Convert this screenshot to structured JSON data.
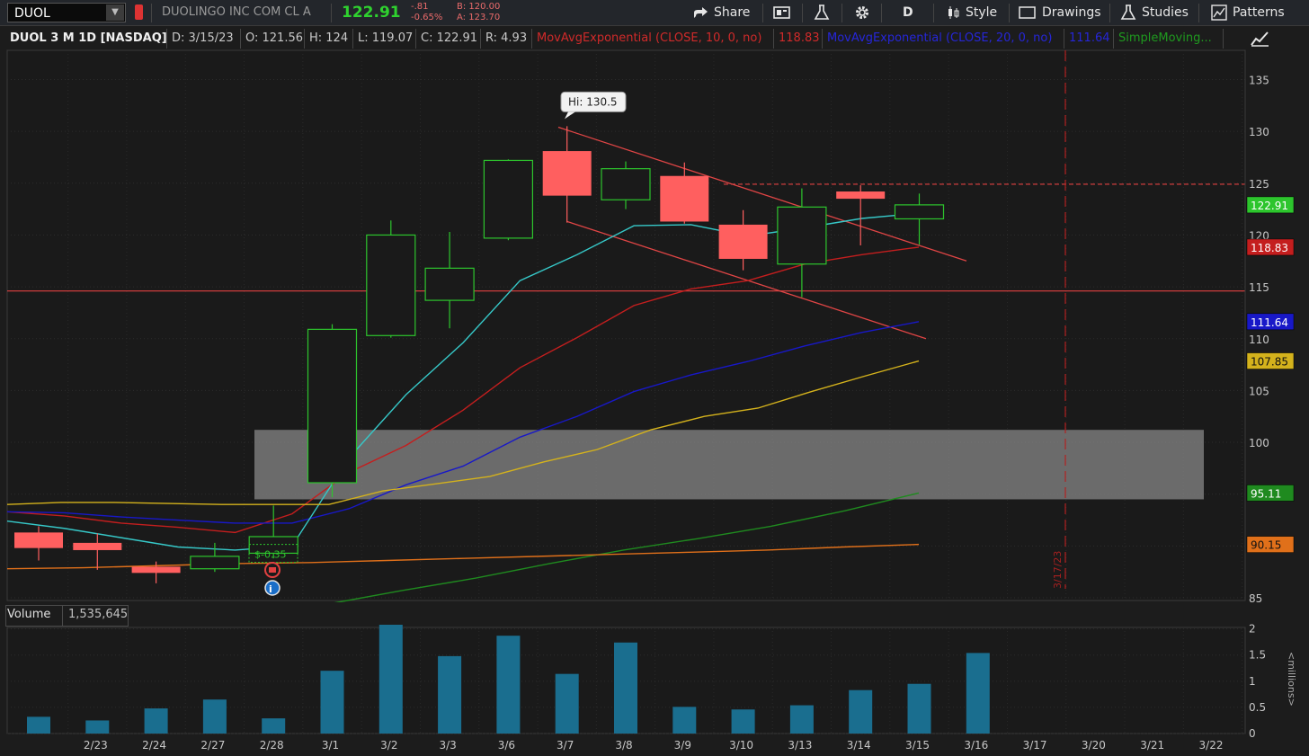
{
  "toolbar": {
    "symbol": "DUOL",
    "company": "DUOLINGO INC COM CL A",
    "last": "122.91",
    "net_change": "-.81",
    "pct_change": "-0.65%",
    "bid": "B: 120.00",
    "ask": "A: 123.70",
    "share": "Share",
    "period_button": "D",
    "style": "Style",
    "drawings": "Drawings",
    "studies": "Studies",
    "patterns": "Patterns"
  },
  "study_header": {
    "title": "DUOL 3 M 1D [NASDAQ]",
    "date": "D: 3/15/23",
    "open": "O: 121.56",
    "high": "H: 124",
    "low": "L: 119.07",
    "close": "C: 122.91",
    "range": "R: 4.93",
    "ema10_label": "MovAvgExponential (CLOSE, 10, 0, no)",
    "ema10_value": "118.83",
    "ema20_label": "MovAvgExponential (CLOSE, 20, 0, no)",
    "ema20_value": "111.64",
    "sma_label": "SimpleMoving..."
  },
  "volume_pane": {
    "label": "Volume",
    "value": "1,535,645",
    "unit_label": "<millions>"
  },
  "colors": {
    "up": "#2dc52d",
    "down": "#ff5f5f",
    "ema10": "#c41e1e",
    "ema20": "#1818c8",
    "ema8": "#36c8c8",
    "sma_yellow": "#d4b21c",
    "sma_green": "#1f8a1f",
    "sma_orange": "#e0701a",
    "volume": "#1a6e8f"
  },
  "chart_data": {
    "type": "candlestick",
    "x_labels": [
      "2/23",
      "2/24",
      "2/27",
      "2/28",
      "3/1",
      "3/2",
      "3/3",
      "3/6",
      "3/7",
      "3/8",
      "3/9",
      "3/10",
      "3/13",
      "3/14",
      "3/15",
      "3/16",
      "3/17",
      "3/20",
      "3/21",
      "3/22"
    ],
    "candles": [
      {
        "date": "2/22",
        "open": 91.3,
        "high": 91.9,
        "low": 88.6,
        "close": 89.8
      },
      {
        "date": "2/23",
        "open": 90.3,
        "high": 91.2,
        "low": 87.7,
        "close": 89.6
      },
      {
        "date": "2/24",
        "open": 88.0,
        "high": 88.5,
        "low": 86.4,
        "close": 87.4
      },
      {
        "date": "2/27",
        "open": 87.8,
        "high": 90.3,
        "low": 87.5,
        "close": 89.0
      },
      {
        "date": "2/28",
        "open": 89.3,
        "high": 93.9,
        "low": 88.8,
        "close": 90.9
      },
      {
        "date": "3/1",
        "open": 96.1,
        "high": 111.4,
        "low": 94.7,
        "close": 110.9
      },
      {
        "date": "3/2",
        "open": 110.3,
        "high": 121.4,
        "low": 110.1,
        "close": 120.0
      },
      {
        "date": "3/3",
        "open": 113.7,
        "high": 120.3,
        "low": 111.0,
        "close": 116.8
      },
      {
        "date": "3/6",
        "open": 119.7,
        "high": 127.3,
        "low": 119.5,
        "close": 127.2
      },
      {
        "date": "3/7",
        "open": 128.1,
        "high": 130.5,
        "low": 121.2,
        "close": 123.8
      },
      {
        "date": "3/8",
        "open": 123.4,
        "high": 127.1,
        "low": 122.5,
        "close": 126.4
      },
      {
        "date": "3/9",
        "open": 125.7,
        "high": 127.0,
        "low": 121.1,
        "close": 121.3
      },
      {
        "date": "3/10",
        "open": 121.0,
        "high": 122.4,
        "low": 116.6,
        "close": 117.7
      },
      {
        "date": "3/13",
        "open": 117.2,
        "high": 124.5,
        "low": 114.0,
        "close": 122.7
      },
      {
        "date": "3/14",
        "open": 124.2,
        "high": 124.8,
        "low": 119.0,
        "close": 123.5
      },
      {
        "date": "3/15",
        "open": 121.56,
        "high": 124.0,
        "low": 119.07,
        "close": 122.91
      }
    ],
    "moving_averages": [
      {
        "name": "MovAvgExponential (CLOSE, 10, 0, no)",
        "color": "#c41e1e",
        "values": [
          93.3,
          92.9,
          92.2,
          91.8,
          91.3,
          93.1,
          97.1,
          99.7,
          103.1,
          107.2,
          110.1,
          113.2,
          114.8,
          115.6,
          117.2,
          118.1,
          118.83
        ]
      },
      {
        "name": "MovAvgExponential (CLOSE, 20, 0, no)",
        "color": "#1818c8",
        "values": [
          93.3,
          93.2,
          92.8,
          92.5,
          92.2,
          92.2,
          93.6,
          95.9,
          97.7,
          100.5,
          102.5,
          104.9,
          106.5,
          107.8,
          109.3,
          110.6,
          111.64
        ]
      },
      {
        "name": "EMA (8)",
        "color": "#36c8c8",
        "values": [
          92.4,
          91.7,
          90.8,
          89.9,
          89.6,
          90.0,
          98.5,
          104.6,
          109.6,
          115.6,
          118.1,
          120.9,
          121.0,
          119.9,
          120.7,
          121.6,
          122.1
        ]
      },
      {
        "name": "SimpleMoving (yellow)",
        "color": "#d4b21c",
        "values": [
          94.0,
          94.2,
          94.2,
          94.1,
          94.0,
          94.0,
          94.0,
          95.3,
          96.0,
          96.7,
          98.1,
          99.3,
          101.2,
          102.5,
          103.3,
          104.9,
          106.4,
          107.85
        ]
      },
      {
        "name": "SimpleMoving (green)",
        "color": "#1f8a1f",
        "values": [
          84.4,
          85.7,
          86.9,
          88.3,
          89.6,
          90.7,
          91.9,
          93.4,
          95.11
        ]
      },
      {
        "name": "SimpleMoving (orange)",
        "color": "#e0701a",
        "values": [
          87.8,
          87.9,
          88.1,
          88.3,
          88.4,
          88.6,
          88.8,
          89.0,
          89.2,
          89.4,
          89.6,
          89.9,
          90.15
        ]
      }
    ],
    "price_tags": [
      {
        "value": "122.91",
        "color": "#2dc52d"
      },
      {
        "value": "118.83",
        "color": "#c41e1e"
      },
      {
        "value": "111.64",
        "color": "#1818c8"
      },
      {
        "value": "107.85",
        "color": "#d4b21c"
      },
      {
        "value": "95.11",
        "color": "#1f8a1f"
      },
      {
        "value": "90.15",
        "color": "#e0701a"
      }
    ],
    "annotations": {
      "hi_bubble": "Hi: 130.5",
      "fill_label": "$-0.35",
      "vertical_marker_label": "3/17/23",
      "horizontal_levels": [
        114.6,
        124.9
      ],
      "zone": {
        "from": 94.5,
        "to": 101.2
      }
    },
    "y_ticks": [
      85,
      90,
      95,
      100,
      105,
      110,
      115,
      120,
      125,
      130,
      135
    ],
    "ylim": [
      85,
      137
    ],
    "volume": {
      "unit": "millions",
      "values": [
        0.32,
        0.25,
        0.48,
        0.65,
        0.29,
        1.2,
        2.08,
        1.48,
        1.87,
        1.14,
        1.74,
        0.51,
        0.46,
        0.54,
        0.83,
        0.95,
        1.54
      ],
      "y_ticks": [
        "0",
        "0.5",
        "1",
        "1.5",
        "2"
      ],
      "ylim": [
        0,
        2.2
      ]
    }
  }
}
